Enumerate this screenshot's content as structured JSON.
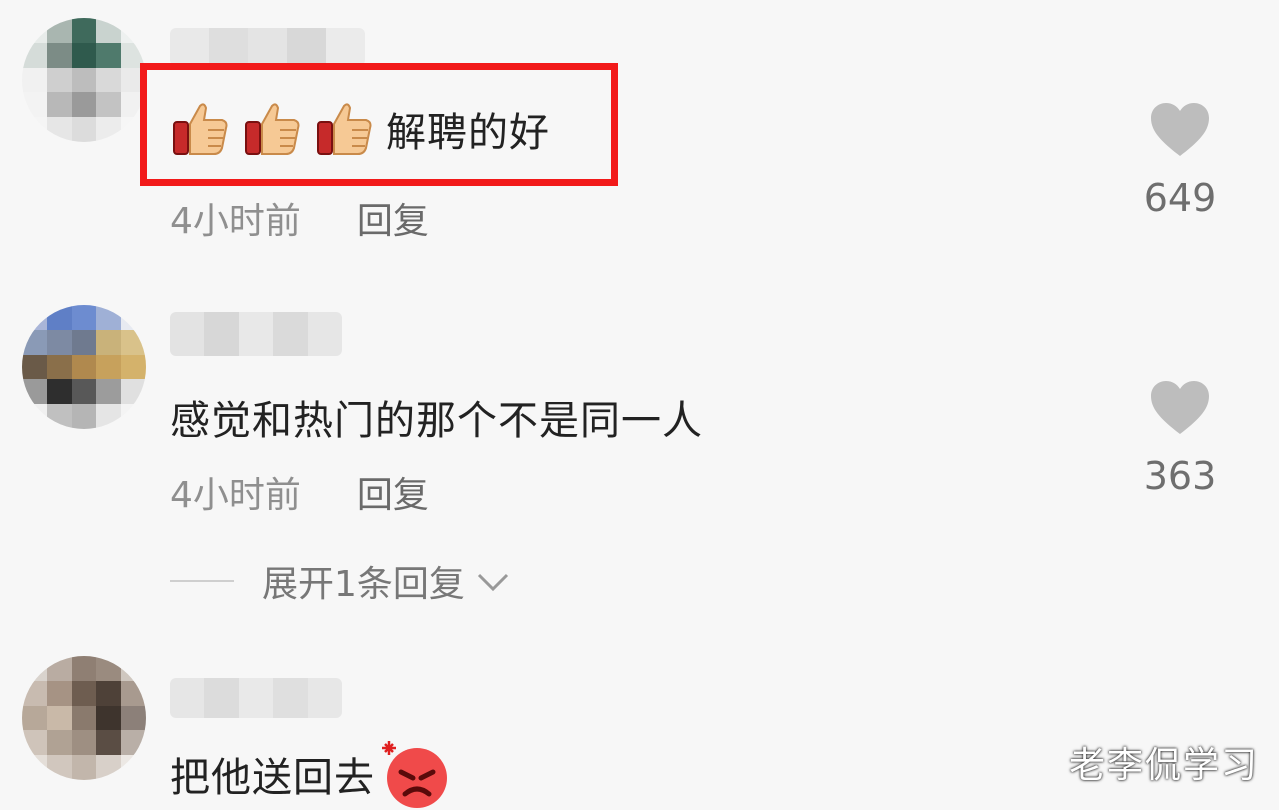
{
  "comments": [
    {
      "text": "解聘的好",
      "time": "4小时前",
      "reply_label": "回复",
      "like_count": "649",
      "emoji_prefix": [
        "thumbs-up-icon",
        "thumbs-up-icon",
        "thumbs-up-icon"
      ]
    },
    {
      "text": "感觉和热门的那个不是同一人",
      "time": "4小时前",
      "reply_label": "回复",
      "like_count": "363",
      "expand_label": "展开1条回复"
    },
    {
      "text": "把他送回去",
      "emoji_suffix": "angry-face-icon"
    }
  ],
  "watermark": "老李侃学习",
  "colors": {
    "highlight_border": "#f21a1a",
    "like_icon": "#bdbdbd"
  }
}
